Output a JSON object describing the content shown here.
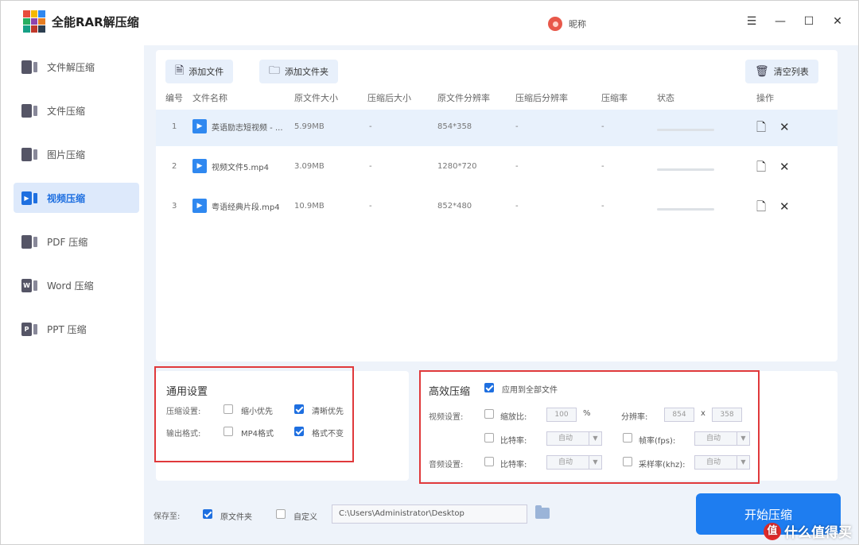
{
  "app": {
    "title": "全能RAR解压缩",
    "user_name": "昵称"
  },
  "window_controls": [
    "☰",
    "—",
    "☐",
    "✕"
  ],
  "sidebar": {
    "items": [
      {
        "label": "文件解压缩",
        "icon": "doc-extract-icon",
        "glyph": ""
      },
      {
        "label": "文件压缩",
        "icon": "doc-compress-icon",
        "glyph": ""
      },
      {
        "label": "图片压缩",
        "icon": "image-compress-icon",
        "glyph": ""
      },
      {
        "label": "视频压缩",
        "icon": "video-compress-icon",
        "glyph": "▶",
        "active": true
      },
      {
        "label": "PDF 压缩",
        "icon": "pdf-compress-icon",
        "glyph": ""
      },
      {
        "label": "Word 压缩",
        "icon": "word-compress-icon",
        "glyph": "W"
      },
      {
        "label": "PPT 压缩",
        "icon": "ppt-compress-icon",
        "glyph": "P"
      }
    ]
  },
  "toolbar": {
    "add_file": "添加文件",
    "add_folder": "添加文件夹",
    "clear_list": "清空列表"
  },
  "table": {
    "columns": [
      "编号",
      "文件名称",
      "原文件大小",
      "压缩后大小",
      "原文件分辨率",
      "压缩后分辨率",
      "压缩率",
      "状态",
      "操作"
    ],
    "rows": [
      {
        "num": "1",
        "name": "英语励志短视频 - ...",
        "size": "5.99MB",
        "csize": "-",
        "res": "854*358",
        "cres": "-",
        "rate": "-"
      },
      {
        "num": "2",
        "name": "视频文件5.mp4",
        "size": "3.09MB",
        "csize": "-",
        "res": "1280*720",
        "cres": "-",
        "rate": "-"
      },
      {
        "num": "3",
        "name": "粤语经典片段.mp4",
        "size": "10.9MB",
        "csize": "-",
        "res": "852*480",
        "cres": "-",
        "rate": "-"
      }
    ]
  },
  "general": {
    "title": "通用设置",
    "compress_label": "压缩设置:",
    "opt_small": "缩小优先",
    "opt_clear": "清晰优先",
    "output_label": "输出格式:",
    "opt_mp4": "MP4格式",
    "opt_keep": "格式不变"
  },
  "efficient": {
    "title": "高效压缩",
    "apply_all": "应用到全部文件",
    "video_label": "视频设置:",
    "scale_label": "缩放比:",
    "scale_value": "100",
    "percent": "%",
    "res_label": "分辨率:",
    "res_w": "854",
    "res_x": "x",
    "res_h": "358",
    "bitrate_label": "比特率:",
    "bitrate_value": "自动",
    "fps_label": "帧率(fps):",
    "fps_value": "自动",
    "audio_label": "音频设置:",
    "abitrate_label": "比特率:",
    "abitrate_value": "自动",
    "sample_label": "采样率(khz):",
    "sample_value": "自动"
  },
  "bottom": {
    "save_label": "保存至:",
    "orig_folder": "原文件夹",
    "custom": "自定义",
    "path": "C:\\Users\\Administrator\\Desktop",
    "start": "开始压缩"
  },
  "watermark": {
    "badge": "值",
    "text": "什么值得买"
  },
  "colors": {
    "accent": "#1e7df0",
    "highlight_box": "#e0393b",
    "selected_row": "#e8f1fc"
  }
}
